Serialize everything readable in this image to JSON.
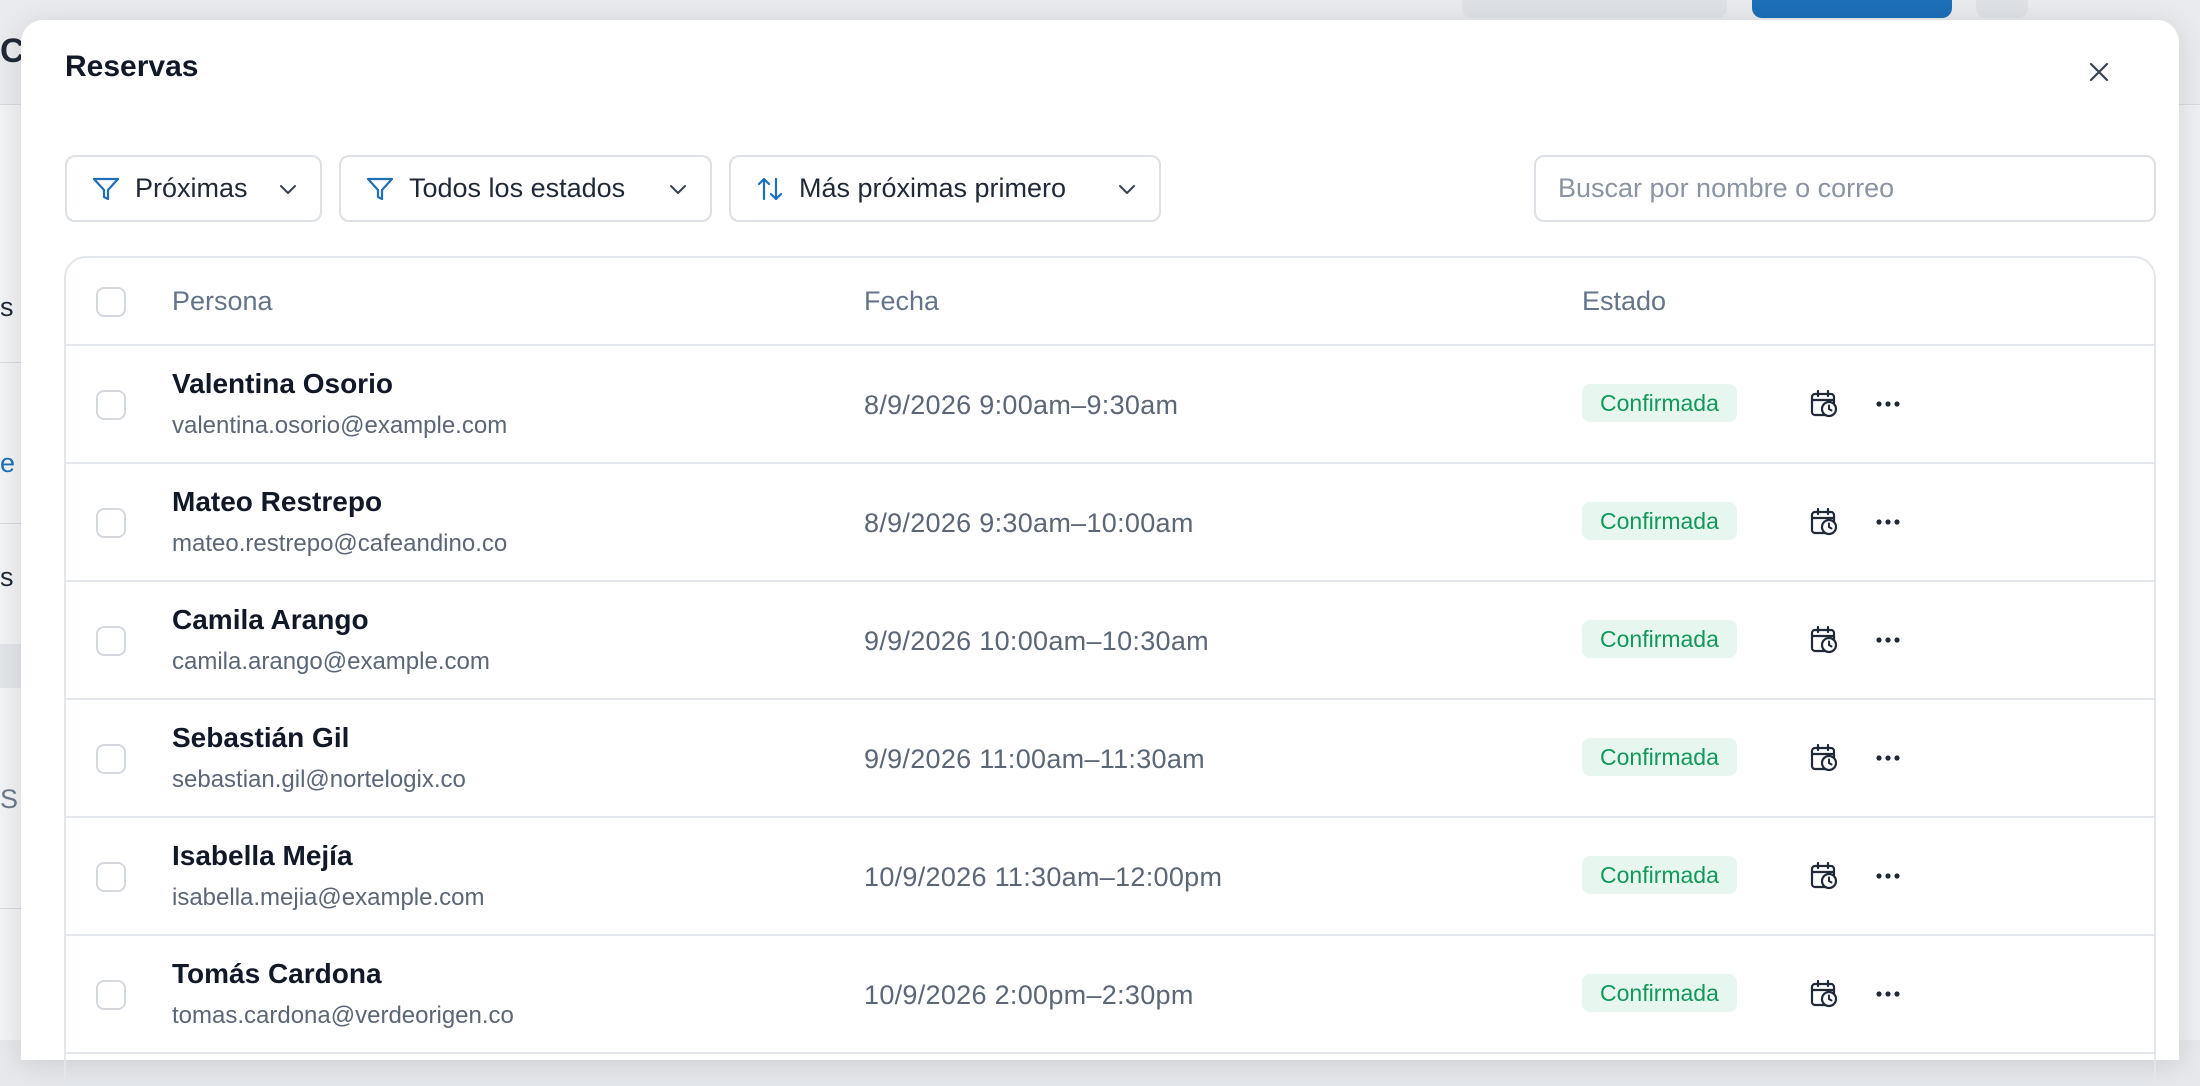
{
  "background": {
    "fragments": [
      "C",
      "s",
      "e",
      "s",
      "S"
    ]
  },
  "modal": {
    "title": "Reservas",
    "close_icon": "close-icon"
  },
  "filters": {
    "time": {
      "label": "Próximas",
      "icon": "filter-icon"
    },
    "status": {
      "label": "Todos los estados",
      "icon": "filter-icon"
    },
    "sort": {
      "label": "Más próximas primero",
      "icon": "sort-icon"
    }
  },
  "search": {
    "placeholder": "Buscar por nombre o correo",
    "value": ""
  },
  "table": {
    "columns": {
      "person": "Persona",
      "date": "Fecha",
      "status": "Estado"
    },
    "rows": [
      {
        "name": "Valentina Osorio",
        "email": "valentina.osorio@example.com",
        "date": "8/9/2026 9:00am–9:30am",
        "status": "Confirmada"
      },
      {
        "name": "Mateo Restrepo",
        "email": "mateo.restrepo@cafeandino.co",
        "date": "8/9/2026 9:30am–10:00am",
        "status": "Confirmada"
      },
      {
        "name": "Camila Arango",
        "email": "camila.arango@example.com",
        "date": "9/9/2026 10:00am–10:30am",
        "status": "Confirmada"
      },
      {
        "name": "Sebastián Gil",
        "email": "sebastian.gil@nortelogix.co",
        "date": "9/9/2026 11:00am–11:30am",
        "status": "Confirmada"
      },
      {
        "name": "Isabella Mejía",
        "email": "isabella.mejia@example.com",
        "date": "10/9/2026 11:30am–12:00pm",
        "status": "Confirmada"
      },
      {
        "name": "Tomás Cardona",
        "email": "tomas.cardona@verdeorigen.co",
        "date": "10/9/2026 2:00pm–2:30pm",
        "status": "Confirmada"
      }
    ]
  },
  "colors": {
    "status_confirmed_bg": "#e7f6ee",
    "status_confirmed_text": "#12995a",
    "accent_blue": "#1d6fb8"
  }
}
